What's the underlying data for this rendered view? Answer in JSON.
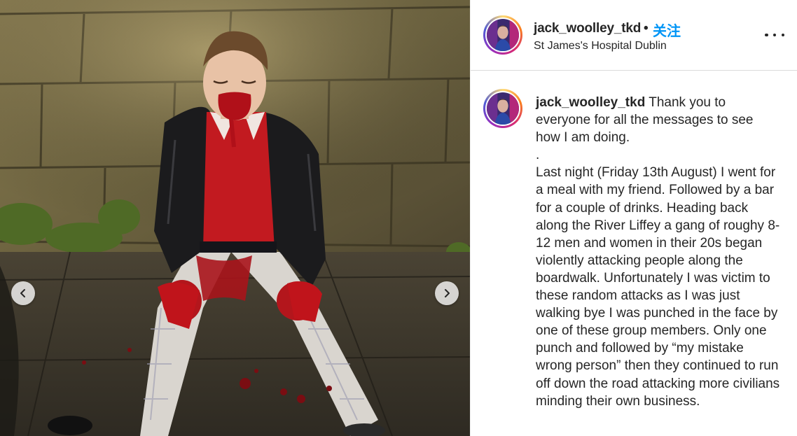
{
  "post": {
    "username": "jack_woolley_tkd",
    "separator": "•",
    "follow_label": "关注",
    "location": "St James's Hospital Dublin",
    "more_icon": "more-options-icon"
  },
  "caption": {
    "username": "jack_woolley_tkd",
    "text": " Thank you to everyone for all the messages to see how I am doing.\n.\nLast night (Friday 13th August) I went for a meal with my friend. Followed by a bar for a couple of drinks. Heading back along the River Liffey a gang of roughy 8-12 men and women in their 20s began violently attacking people along the boardwalk. Unfortunately I was victim to these random attacks as I was just walking bye I was punched in the face by one of these group members. Only one punch and followed by “my mistake wrong person” then they continued to run off down the road attacking more civilians minding their own business."
  },
  "carousel": {
    "prev_icon": "chevron-left-icon",
    "next_icon": "chevron-right-icon"
  },
  "colors": {
    "accent": "#0095f6",
    "text": "#262626",
    "divider": "#dbdbdb"
  }
}
